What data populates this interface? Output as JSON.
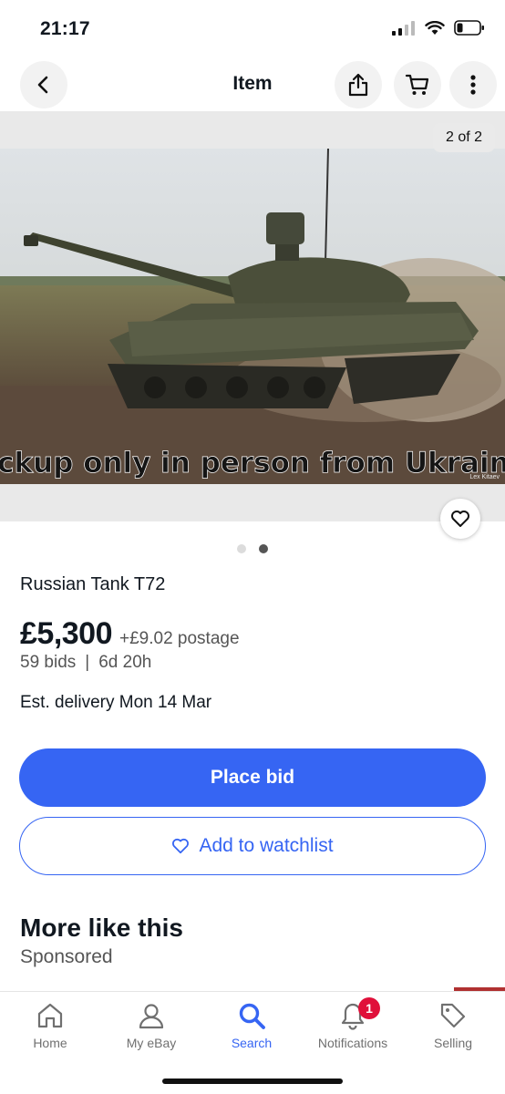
{
  "status_bar": {
    "time": "21:17"
  },
  "nav": {
    "title": "Item"
  },
  "gallery": {
    "counter": "2 of 2",
    "photo_caption": "pickup only in person from Ukraine",
    "photo_credit": "Lex Kitaev",
    "page_count": 2,
    "active_page": 2
  },
  "item": {
    "title": "Russian Tank T72",
    "price": "£5,300",
    "postage": "+£9.02 postage",
    "bids": "59 bids",
    "separator": "|",
    "time_left": "6d 20h",
    "delivery": "Est. delivery Mon 14 Mar"
  },
  "actions": {
    "place_bid": "Place bid",
    "add_watchlist": "Add to watchlist"
  },
  "more": {
    "title": "More like this",
    "sponsored": "Sponsored"
  },
  "tabs": [
    {
      "label": "Home",
      "icon": "home-icon"
    },
    {
      "label": "My eBay",
      "icon": "user-icon"
    },
    {
      "label": "Search",
      "icon": "search-icon"
    },
    {
      "label": "Notifications",
      "icon": "bell-icon",
      "badge": "1"
    },
    {
      "label": "Selling",
      "icon": "tag-icon"
    }
  ],
  "colors": {
    "accent": "#3665f3",
    "badge": "#e0103a"
  }
}
